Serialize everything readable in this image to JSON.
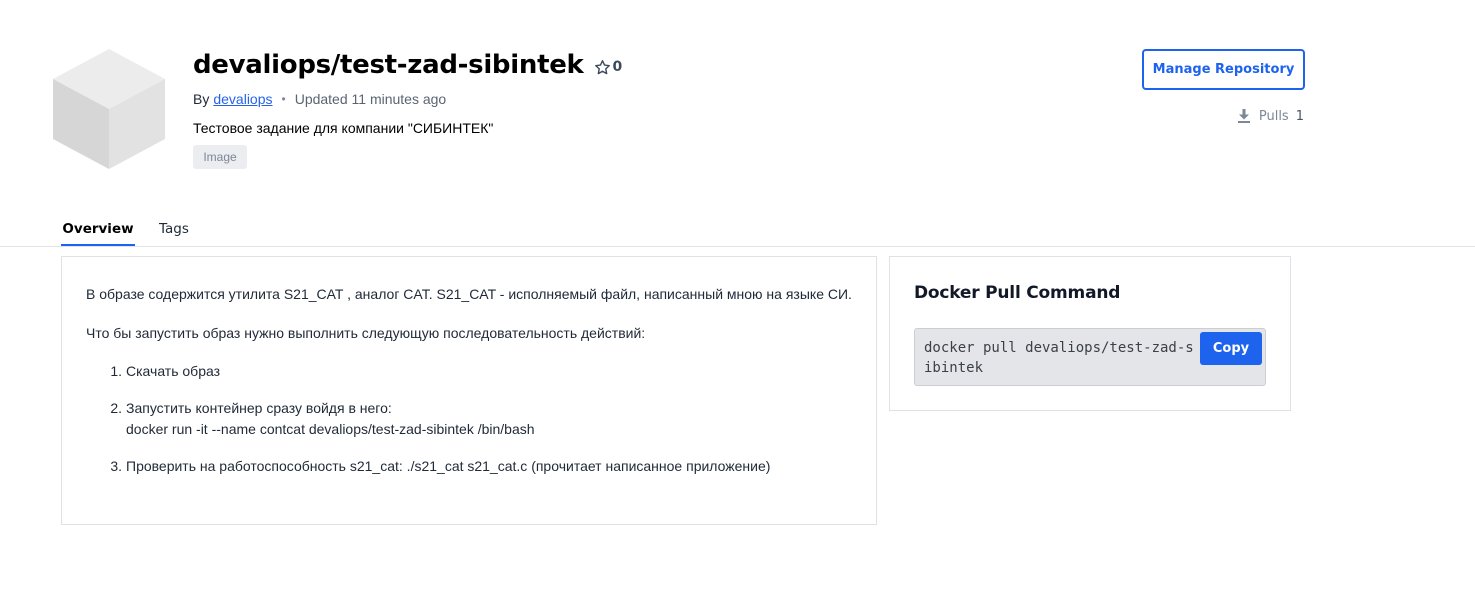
{
  "repo": {
    "title": "devaliops/test-zad-sibintek",
    "stars": "0",
    "by_label": "By",
    "author": "devaliops",
    "separator": "•",
    "updated": "Updated 11 minutes ago",
    "description": "Тестовое задание для компании \"СИБИНТЕК\"",
    "badge": "Image",
    "logo_icon": "cube-icon",
    "star_icon": "star-outline-icon"
  },
  "actions": {
    "manage_label": "Manage Repository",
    "pulls_icon": "download-icon",
    "pulls_label": "Pulls",
    "pulls_count": "1"
  },
  "tabs": [
    {
      "label": "Overview",
      "active": true
    },
    {
      "label": "Tags",
      "active": false
    }
  ],
  "overview": {
    "paragraphs": [
      "В образе содержится утилита S21_CAT , аналог CAT. S21_CAT - исполняемый файл, написанный мною на языке СИ.",
      "Что бы запустить образ нужно выполнить следующую последовательность действий:"
    ],
    "steps": [
      {
        "num": "1.",
        "line1": "Скачать образ",
        "line2": ""
      },
      {
        "num": "2.",
        "line1": "Запустить контейнер сразу войдя в него:",
        "line2": "docker run -it --name contcat devaliops/test-zad-sibintek /bin/bash"
      },
      {
        "num": "3.",
        "line1": "Проверить на работоспособность s21_cat: ./s21_cat s21_cat.c (прочитает написанное приложение)",
        "line2": ""
      }
    ]
  },
  "pull_command": {
    "title": "Docker Pull Command",
    "command": "docker pull devaliops/test-zad-sibintek",
    "copy_label": "Copy"
  },
  "colors": {
    "accent": "#1d63ed",
    "border": "#dfe1e6",
    "badge_bg": "#ebedf0",
    "cmd_bg": "#e4e5e9"
  }
}
